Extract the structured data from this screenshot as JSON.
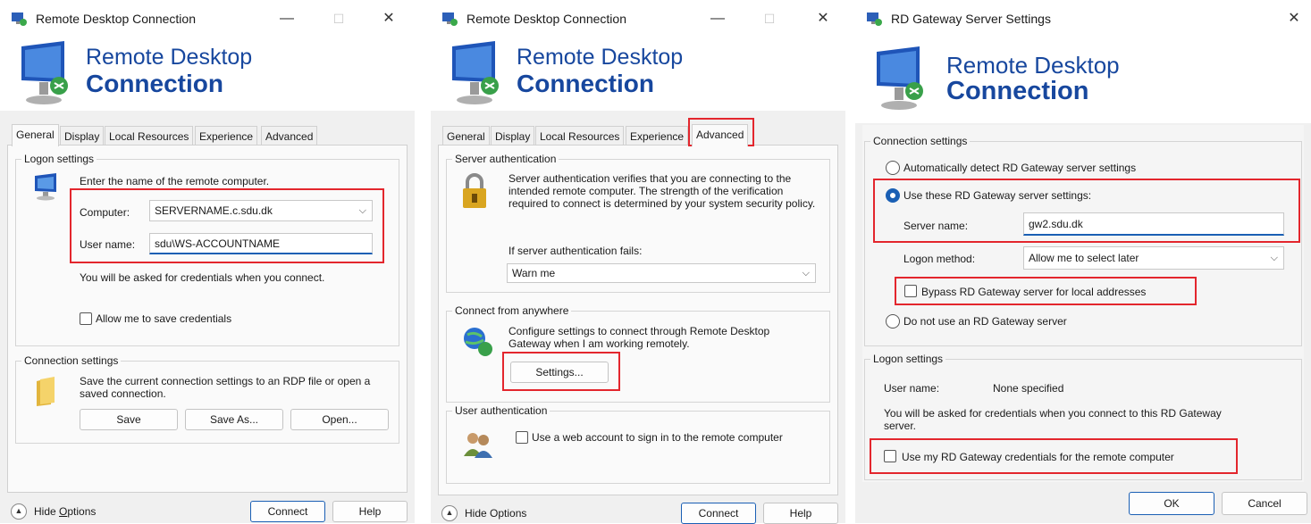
{
  "win1": {
    "title": "Remote Desktop Connection",
    "banner_line1": "Remote Desktop",
    "banner_line2": "Connection",
    "tabs": [
      "General",
      "Display",
      "Local Resources",
      "Experience",
      "Advanced"
    ],
    "logon_group": "Logon settings",
    "enter_name": "Enter the name of the remote computer.",
    "computer_label": "Computer:",
    "computer_value": "SERVERNAME.c.sdu.dk",
    "username_label": "User name:",
    "username_value": "sdu\\WS-ACCOUNTNAME",
    "credentials_note": "You will be asked for credentials when you connect.",
    "allow_save": "Allow me to save credentials",
    "conn_group": "Connection settings",
    "conn_desc": "Save the current connection settings to an RDP file or open a saved connection.",
    "save": "Save",
    "save_as": "Save As...",
    "open": "Open...",
    "hide_options_pre": "Hide ",
    "hide_options_ul": "O",
    "hide_options_post": "ptions",
    "connect": "Connect",
    "help": "Help"
  },
  "win2": {
    "title": "Remote Desktop Connection",
    "banner_line1": "Remote Desktop",
    "banner_line2": "Connection",
    "tabs": [
      "General",
      "Display",
      "Local Resources",
      "Experience",
      "Advanced"
    ],
    "server_auth_group": "Server authentication",
    "server_auth_desc": "Server authentication verifies that you are connecting to the intended remote computer. The strength of the verification required to connect is determined by your system security policy.",
    "if_fails": "If server authentication fails:",
    "fails_value": "Warn me",
    "anywhere_group": "Connect from anywhere",
    "anywhere_desc": "Configure settings to connect through Remote Desktop Gateway when I am working remotely.",
    "settings_btn": "Settings...",
    "user_auth_group": "User authentication",
    "web_account": "Use a web account to sign in to the remote computer",
    "hide_options_pre": "Hide Options",
    "connect": "Connect",
    "help": "Help"
  },
  "win3": {
    "title": "RD Gateway Server Settings",
    "banner_line1": "Remote Desktop",
    "banner_line2": "Connection",
    "conn_group": "Connection settings",
    "auto_detect": "Automatically detect RD Gateway server settings",
    "use_these": "Use these RD Gateway server settings:",
    "server_name_label": "Server name:",
    "server_name_value": "gw2.sdu.dk",
    "logon_method_label": "Logon method:",
    "logon_method_value": "Allow me to select later",
    "bypass": "Bypass RD Gateway server for local addresses",
    "do_not_use": "Do not use an RD Gateway server",
    "logon_group": "Logon settings",
    "username_label": "User name:",
    "username_value": "None specified",
    "cred_note": "You will be asked for credentials when you connect to this RD Gateway server.",
    "use_my_creds": "Use my RD Gateway credentials for the remote computer",
    "ok": "OK",
    "cancel": "Cancel"
  },
  "colors": {
    "brand_blue": "#17479e",
    "highlight_red": "#e3262d",
    "accent": "#1a5fb4"
  }
}
